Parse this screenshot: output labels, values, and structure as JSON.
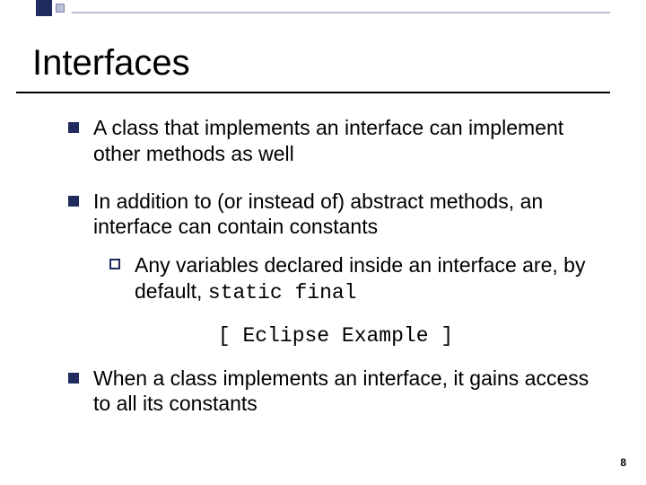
{
  "slide": {
    "title": "Interfaces",
    "page_number": "8",
    "bullets": [
      {
        "text": "A class that implements an interface can implement other methods as well"
      },
      {
        "text": "In addition to (or instead of) abstract methods, an interface can contain constants",
        "sub": {
          "prefix": "Any variables declared inside an interface are, by default, ",
          "code": "static final"
        }
      },
      {
        "text": "When a class implements an interface, it gains access to all its constants"
      }
    ],
    "example_text": "[ Eclipse Example ]"
  }
}
